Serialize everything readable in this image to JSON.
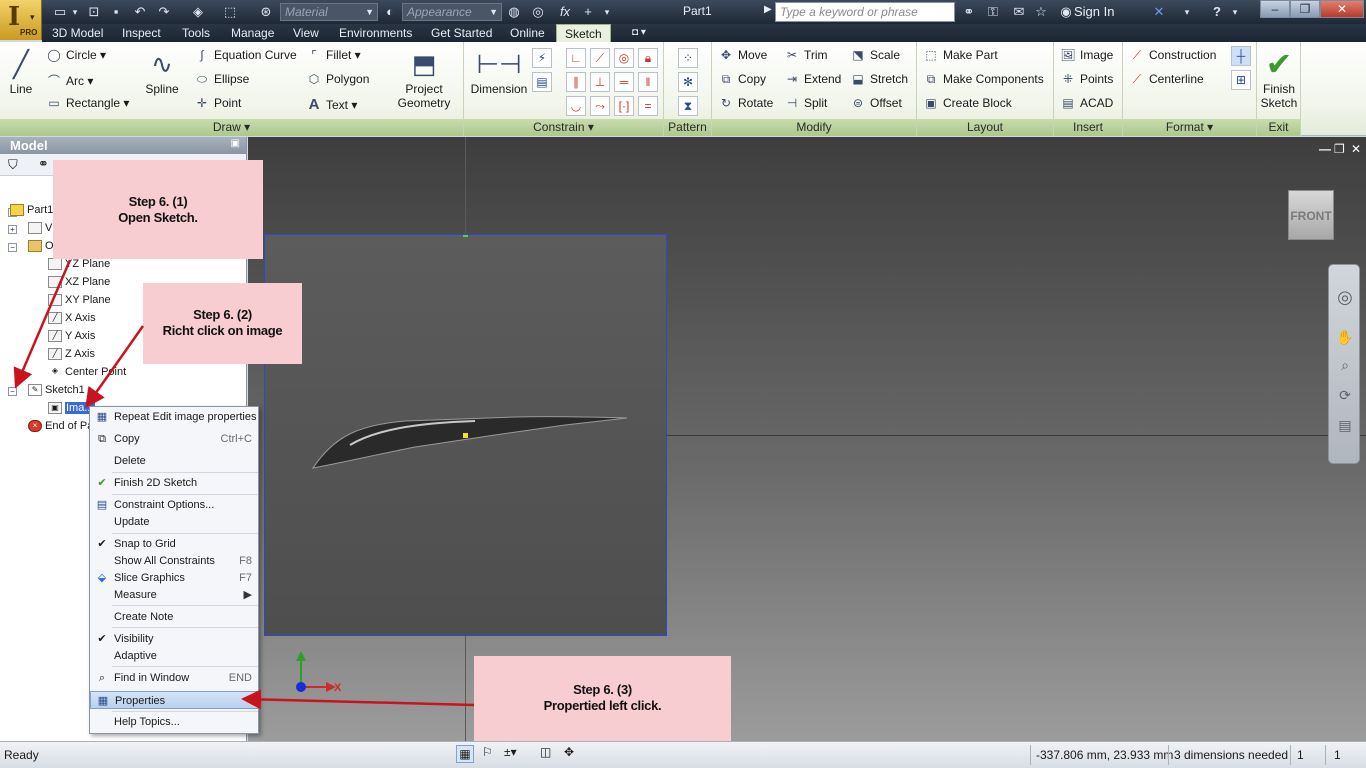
{
  "app": {
    "pro_label": "PRO",
    "document_title": "Part1"
  },
  "quick_access": {
    "material_placeholder": "Material",
    "appearance_placeholder": "Appearance",
    "fx_label": "fx"
  },
  "help_bar": {
    "search_placeholder": "Type a keyword or phrase",
    "sign_in_label": "Sign In"
  },
  "tabs": [
    {
      "label": "3D Model"
    },
    {
      "label": "Inspect"
    },
    {
      "label": "Tools"
    },
    {
      "label": "Manage"
    },
    {
      "label": "View"
    },
    {
      "label": "Environments"
    },
    {
      "label": "Get Started"
    },
    {
      "label": "Online"
    },
    {
      "label": "Sketch",
      "active": true
    }
  ],
  "ribbon": {
    "draw": {
      "label": "Draw",
      "line": "Line",
      "circle": "Circle",
      "arc": "Arc",
      "rectangle": "Rectangle",
      "spline": "Spline",
      "equation_curve": "Equation Curve",
      "ellipse": "Ellipse",
      "point": "Point",
      "fillet": "Fillet",
      "polygon": "Polygon",
      "text": "Text",
      "project_geometry": "Project Geometry"
    },
    "constrain": {
      "label": "Constrain",
      "dimension": "Dimension"
    },
    "pattern": {
      "label": "Pattern"
    },
    "modify": {
      "label": "Modify",
      "move": "Move",
      "copy": "Copy",
      "rotate": "Rotate",
      "trim": "Trim",
      "extend": "Extend",
      "split": "Split",
      "scale": "Scale",
      "stretch": "Stretch",
      "offset": "Offset"
    },
    "layout": {
      "label": "Layout",
      "make_part": "Make Part",
      "make_components": "Make Components",
      "create_block": "Create Block"
    },
    "insert": {
      "label": "Insert",
      "image": "Image",
      "points": "Points",
      "acad": "ACAD"
    },
    "format": {
      "label": "Format",
      "construction": "Construction",
      "centerline": "Centerline"
    },
    "exit": {
      "label": "Exit",
      "finish_sketch": "Finish Sketch"
    }
  },
  "browser": {
    "title": "Model",
    "items": {
      "part1": "Part1",
      "view": "V",
      "origin": "O",
      "yz_plane": "YZ Plane",
      "xz_plane": "XZ Plane",
      "xy_plane": "XY Plane",
      "x_axis": "X Axis",
      "y_axis": "Y Axis",
      "z_axis": "Z Axis",
      "center_point": "Center Point",
      "sketch1": "Sketch1",
      "image": "Ima...",
      "end_of_part": "End of Pa"
    }
  },
  "context_menu": {
    "items": [
      {
        "label": "Repeat Edit image properties",
        "shortcut": ""
      },
      {
        "label": "Copy",
        "shortcut": "Ctrl+C"
      },
      {
        "label": "Delete",
        "shortcut": ""
      },
      {
        "label": "Finish 2D Sketch",
        "shortcut": ""
      },
      {
        "label": "Constraint Options...",
        "shortcut": ""
      },
      {
        "label": "Update",
        "shortcut": ""
      },
      {
        "label": "Snap to Grid",
        "shortcut": ""
      },
      {
        "label": "Show All Constraints",
        "shortcut": "F8"
      },
      {
        "label": "Slice Graphics",
        "shortcut": "F7"
      },
      {
        "label": "Measure",
        "shortcut": ""
      },
      {
        "label": "Create Note",
        "shortcut": ""
      },
      {
        "label": "Visibility",
        "shortcut": ""
      },
      {
        "label": "Adaptive",
        "shortcut": ""
      },
      {
        "label": "Find in Window",
        "shortcut": "END"
      },
      {
        "label": "Properties",
        "shortcut": "",
        "highlighted": true
      },
      {
        "label": "Help Topics...",
        "shortcut": ""
      }
    ]
  },
  "callouts": {
    "step1": {
      "title": "Step 6. (1)",
      "text": "Open Sketch."
    },
    "step2": {
      "title": "Step 6. (2)",
      "text": "Richt click on image"
    },
    "step3": {
      "title": "Step 6. (3)",
      "text": "Propertied left click."
    }
  },
  "viewport": {
    "viewcube_label": "FRONT",
    "axis_x_label": "X"
  },
  "status": {
    "ready": "Ready",
    "coordinates": "-337.806 mm, 23.933 mm",
    "dimensions_needed": "3 dimensions needed",
    "count1": "1",
    "count2": "1"
  },
  "colors": {
    "accent": "#2a4ac8",
    "callout_bg": "#f8cdd1",
    "arrow": "#c8141e",
    "ribbon_green": "#adc78c"
  }
}
